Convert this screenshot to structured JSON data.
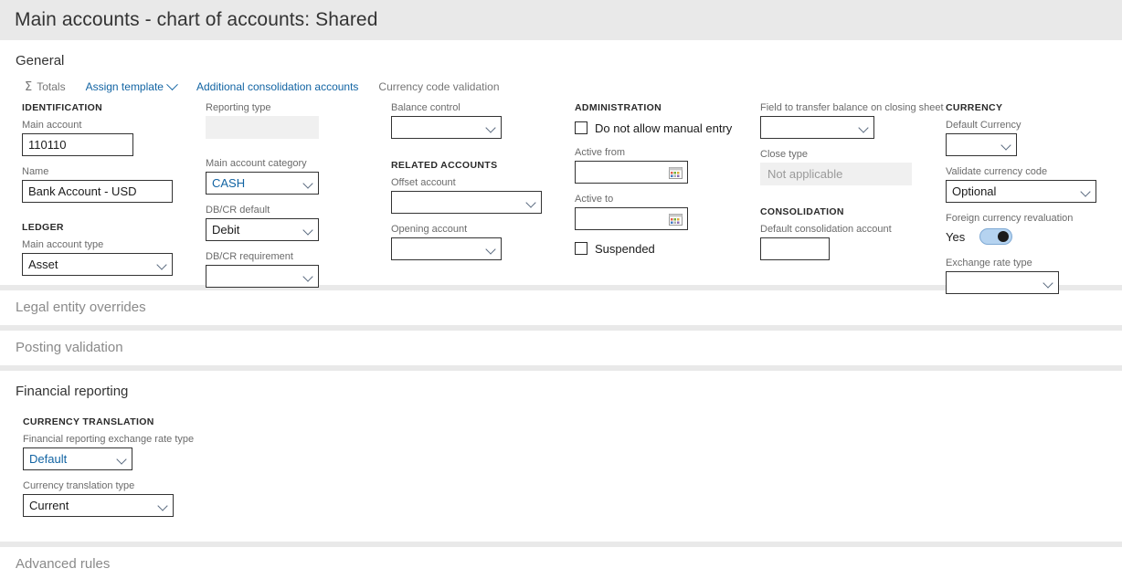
{
  "page": {
    "title": "Main accounts - chart of accounts: Shared"
  },
  "sections": {
    "general": {
      "header": "General",
      "toolbar": [
        {
          "label": "Totals",
          "icon": "sigma-icon",
          "style": "muted"
        },
        {
          "label": "Assign template",
          "icon": "chevron-down-icon",
          "style": "link"
        },
        {
          "label": "Additional consolidation accounts",
          "icon": "",
          "style": "link"
        },
        {
          "label": "Currency code validation",
          "icon": "",
          "style": "muted"
        }
      ],
      "identification": {
        "group": "IDENTIFICATION",
        "main_account_label": "Main account",
        "main_account_value": "110110",
        "name_label": "Name",
        "name_value": "Bank Account - USD"
      },
      "ledger": {
        "group": "LEDGER",
        "main_account_type_label": "Main account type",
        "main_account_type_value": "Asset"
      },
      "classification": {
        "reporting_type_label": "Reporting type",
        "reporting_type_value": "",
        "main_account_category_label": "Main account category",
        "main_account_category_value": "CASH",
        "dbcr_default_label": "DB/CR default",
        "dbcr_default_value": "Debit",
        "dbcr_requirement_label": "DB/CR requirement",
        "dbcr_requirement_value": ""
      },
      "related": {
        "balance_control_label": "Balance control",
        "balance_control_value": "",
        "group": "RELATED ACCOUNTS",
        "offset_account_label": "Offset account",
        "offset_account_value": "",
        "opening_account_label": "Opening account",
        "opening_account_value": ""
      },
      "administration": {
        "group": "ADMINISTRATION",
        "no_manual_entry_label": "Do not allow manual entry",
        "no_manual_entry_checked": false,
        "active_from_label": "Active from",
        "active_from_value": "",
        "active_to_label": "Active to",
        "active_to_value": "",
        "suspended_label": "Suspended",
        "suspended_checked": false
      },
      "closing": {
        "transfer_field_label": "Field to transfer balance on closing sheet",
        "transfer_field_value": "",
        "close_type_label": "Close type",
        "close_type_value": "Not applicable",
        "group": "CONSOLIDATION",
        "default_consolidation_label": "Default consolidation account",
        "default_consolidation_value": ""
      },
      "currency": {
        "group": "CURRENCY",
        "default_currency_label": "Default Currency",
        "default_currency_value": "",
        "validate_code_label": "Validate currency code",
        "validate_code_value": "Optional",
        "fx_reval_label": "Foreign currency revaluation",
        "fx_reval_state": "Yes",
        "exchange_rate_type_label": "Exchange rate type",
        "exchange_rate_type_value": ""
      }
    },
    "legal_entity_overrides": {
      "header": "Legal entity overrides"
    },
    "posting_validation": {
      "header": "Posting validation"
    },
    "financial_reporting": {
      "header": "Financial reporting",
      "group": "CURRENCY TRANSLATION",
      "fr_rate_type_label": "Financial reporting exchange rate type",
      "fr_rate_type_value": "Default",
      "translation_type_label": "Currency translation type",
      "translation_type_value": "Current"
    },
    "advanced_rules": {
      "header": "Advanced rules"
    }
  },
  "colors": {
    "link": "#1264a3",
    "page_bg": "#e9e9e9",
    "panel_bg": "#ffffff",
    "toggle_on": "#b5d3f0"
  }
}
